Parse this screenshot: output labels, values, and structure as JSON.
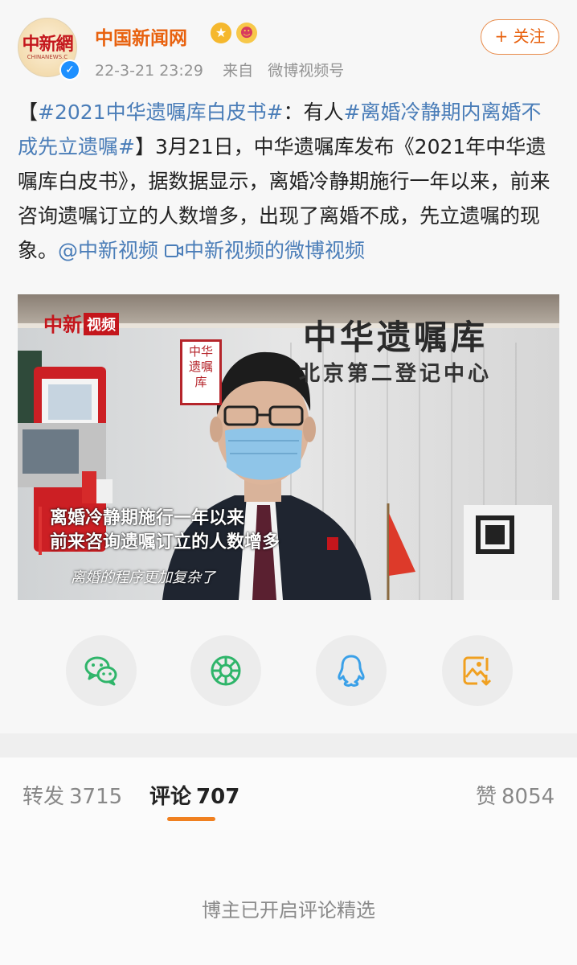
{
  "account": {
    "name": "中国新闻网",
    "avatar_text": "中新網",
    "avatar_subtext": "CHINANEWS.C",
    "verified_mark": "✓",
    "badges": [
      "gold-medal-badge",
      "face-badge"
    ]
  },
  "post": {
    "timestamp": "22-3-21 23:29",
    "source_prefix": "来自",
    "source": "微博视频号",
    "follow_label": "+ 关注",
    "text": {
      "bracket_open": "【",
      "topic1": "#2021中华遗嘱库白皮书#",
      "segment1": "：有人",
      "topic2": "#离婚冷静期内离婚不成先立遗嘱#",
      "segment2": "】3月21日，中华遗嘱库发布《2021年中华遗嘱库白皮书》，据数据显示，离婚冷静期施行一年以来，前来咨询遗嘱订立的人数增多，出现了离婚不成，先立遗嘱的现象。",
      "mention": "@中新视频",
      "video_link": "中新视频的微博视频"
    }
  },
  "video": {
    "watermark": "中新",
    "watermark_tag": "视频",
    "wall_sign": "中华遗嘱库",
    "wall_sign_sub": "北京第二登记中心",
    "plaque": "中华遗嘱库",
    "subtitle_line1": "离婚冷静期施行一年以来",
    "subtitle_line2": "前来咨询遗嘱订立的人数增多",
    "caption": "离婚的程序更加复杂了"
  },
  "share": {
    "buttons": [
      "wechat-icon",
      "moments-icon",
      "qq-icon",
      "save-image-icon"
    ],
    "colors": {
      "wechat": "#2fb56a",
      "moments": "#2fb56a",
      "qq": "#3aa0e8",
      "save": "#f0a020"
    }
  },
  "tabs": [
    {
      "label": "转发",
      "count": "3715"
    },
    {
      "label": "评论",
      "count": "707"
    },
    {
      "label": "赞",
      "count": "8054"
    }
  ],
  "comments": {
    "notice": "博主已开启评论精选"
  },
  "colors": {
    "accent": "#e8610e",
    "link": "#4a7db8",
    "tab_underline": "#f08020"
  }
}
